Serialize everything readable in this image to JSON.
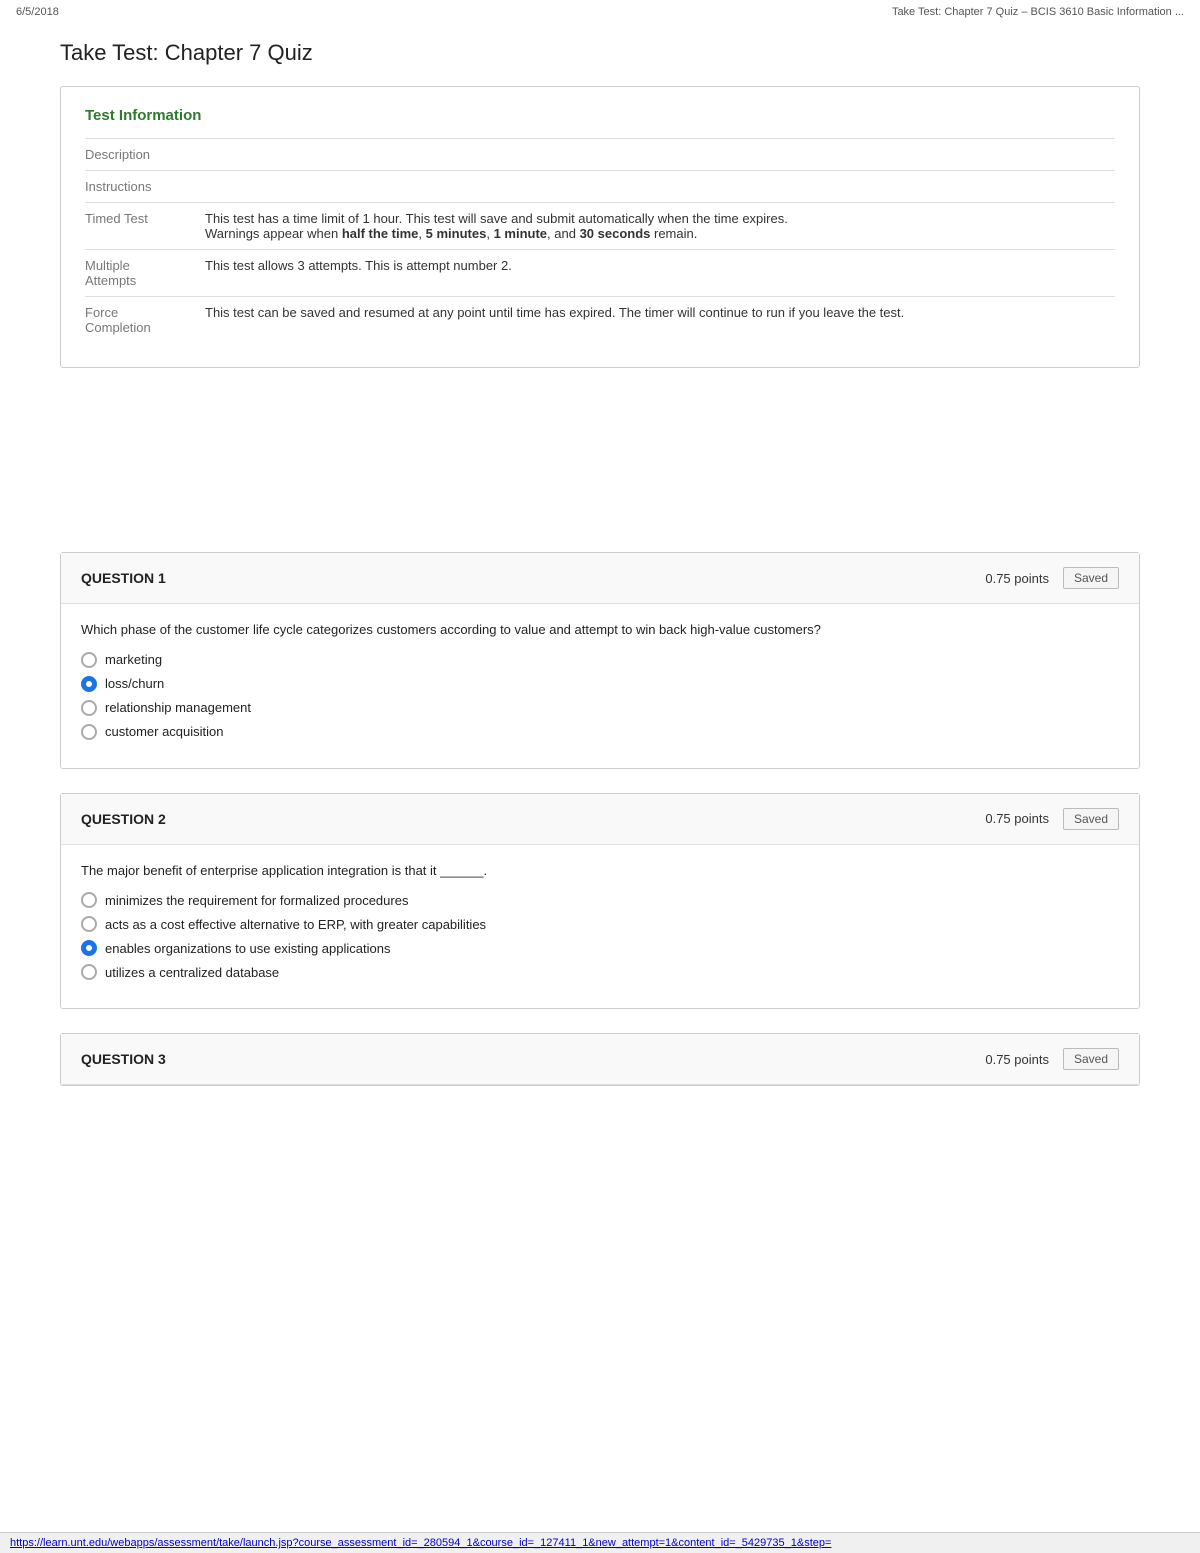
{
  "topbar": {
    "date": "6/5/2018",
    "title": "Take Test: Chapter 7 Quiz – BCIS 3610 Basic Information ..."
  },
  "page_title": "Take Test: Chapter 7 Quiz",
  "test_info": {
    "section_title": "Test Information",
    "rows": [
      {
        "label": "Description",
        "value": ""
      },
      {
        "label": "Instructions",
        "value": ""
      },
      {
        "label": "Timed Test",
        "value_html": "This test has a time limit of 1 hour. This test will save and submit automatically when the time expires.\nWarnings appear when half the time, 5 minutes, 1 minute, and 30 seconds remain."
      },
      {
        "label": "Multiple Attempts",
        "value": "This test allows 3 attempts. This is attempt number 2."
      },
      {
        "label": "Force Completion",
        "value": "This test can be saved and resumed at any point until time has expired. The timer will continue to run if you leave the test."
      }
    ]
  },
  "questions": [
    {
      "number": "QUESTION 1",
      "points": "0.75 points",
      "saved_label": "Saved",
      "text": "Which phase of the customer life cycle categorizes customers according to value and attempt to win back high-value customers?",
      "options": [
        {
          "label": "marketing",
          "selected": false
        },
        {
          "label": "loss/churn",
          "selected": true
        },
        {
          "label": "relationship management",
          "selected": false
        },
        {
          "label": "customer acquisition",
          "selected": false
        }
      ]
    },
    {
      "number": "QUESTION 2",
      "points": "0.75 points",
      "saved_label": "Saved",
      "text": "The major benefit of enterprise application integration is that it ______.",
      "options": [
        {
          "label": "minimizes the requirement for formalized procedures",
          "selected": false
        },
        {
          "label": "acts as a cost effective alternative to ERP, with greater capabilities",
          "selected": false
        },
        {
          "label": "enables organizations to use existing applications",
          "selected": true
        },
        {
          "label": "utilizes a centralized database",
          "selected": false
        }
      ]
    },
    {
      "number": "QUESTION 3",
      "points": "0.75 points",
      "saved_label": "Saved",
      "text": "",
      "options": []
    }
  ],
  "bottom_url": "https://learn.unt.edu/webapps/assessment/take/launch.jsp?course_assessment_id=_280594_1&course_id=_127411_1&new_attempt=1&content_id=_5429735_1&step="
}
